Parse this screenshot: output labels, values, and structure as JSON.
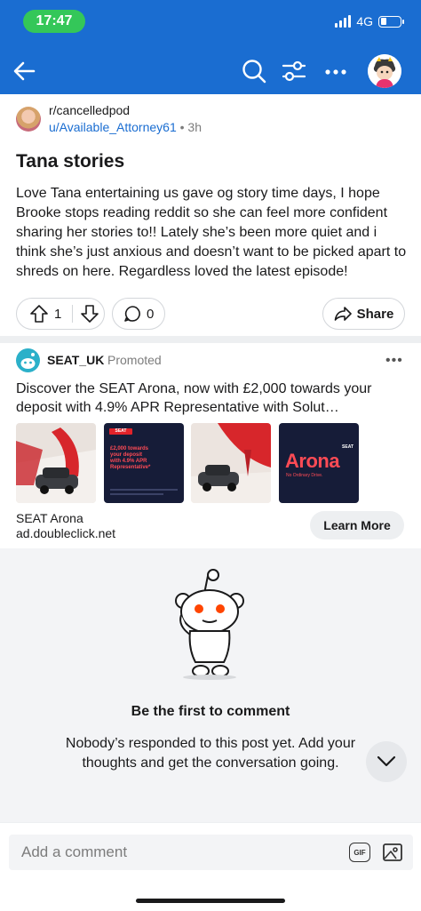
{
  "status_bar": {
    "time": "17:47",
    "network": "4G",
    "battery_level": 0.3
  },
  "header": {
    "back_icon": "arrow-left-icon",
    "search_icon": "search-icon",
    "filter_icon": "sort-icon",
    "more_icon": "more-horizontal-icon",
    "bg_color": "#1a6dd1"
  },
  "post": {
    "subreddit": "r/cancelledpod",
    "author": "u/Available_Attorney61",
    "separator": "•",
    "age": "3h",
    "title": "Tana stories",
    "body": "Love Tana entertaining us gave og story time days, I hope Brooke stops reading reddit so she can feel more confident sharing her stories to!! Lately she’s been more quiet and i think she’s just anxious and doesn’t want to be picked apart to shreds on here. Regardless loved the latest episode!",
    "votes": "1",
    "comments": "0",
    "share_label": "Share"
  },
  "ad": {
    "advertiser": "SEAT_UK",
    "promoted_label": "Promoted",
    "more_label": "•••",
    "text": "Discover the SEAT Arona, now with £2,000 towards your deposit with 4.9% APR Representative with Solut…",
    "thumbnails": [
      {
        "kind": "car-photo"
      },
      {
        "kind": "text-card",
        "logo": "SEAT",
        "lines": [
          "£2,000 towards",
          "your deposit",
          "with 4.9% APR",
          "Representative*"
        ]
      },
      {
        "kind": "car-photo"
      },
      {
        "kind": "brand-card",
        "logo": "SEAT",
        "headline": "Arona",
        "tagline": "No Ordinary Drive."
      }
    ],
    "title": "SEAT Arona",
    "domain": "ad.doubleclick.net",
    "cta": "Learn More"
  },
  "empty_comments": {
    "title": "Be the first to comment",
    "subtitle": "Nobody’s responded to this post yet. Add your thoughts and get the conversation going."
  },
  "comment_bar": {
    "placeholder": "Add a comment",
    "gif_label": "GIF",
    "image_icon": "image-icon"
  }
}
